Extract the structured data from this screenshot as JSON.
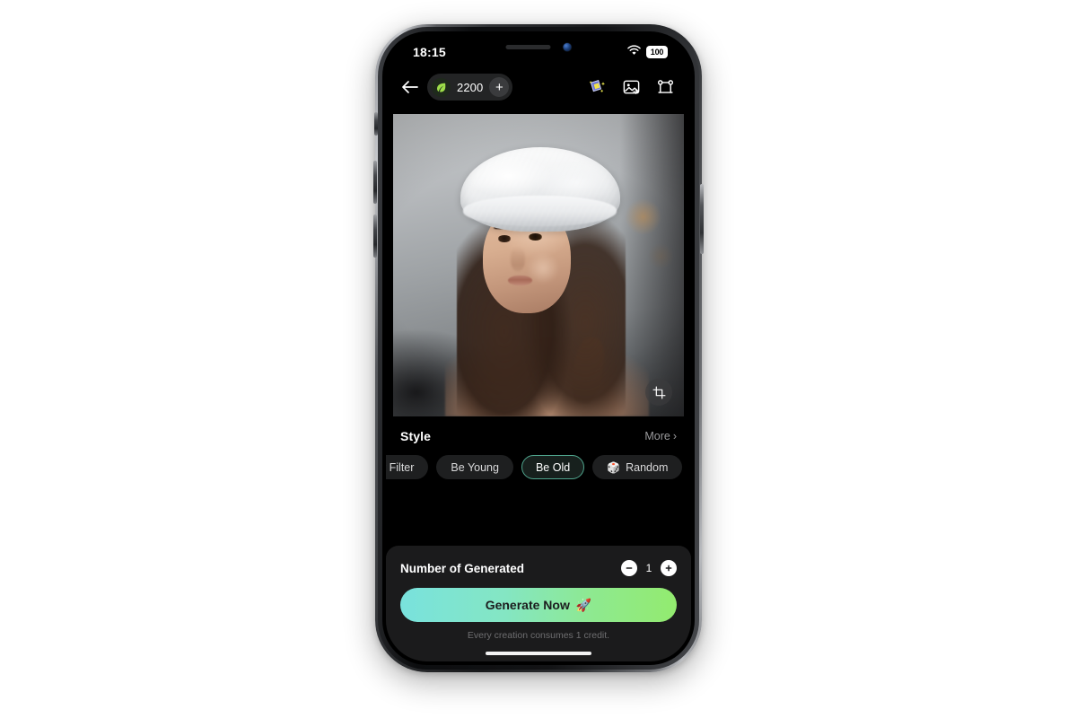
{
  "status_bar": {
    "time": "18:15",
    "wifi_icon": "wifi-icon",
    "battery_level": "100",
    "camera_icon": "front-camera-icon"
  },
  "top_bar": {
    "back_icon": "back-arrow-icon",
    "credit": {
      "leaf_icon": "leaf-icon",
      "value": "2200",
      "add_label": "+"
    },
    "actions": [
      {
        "name": "ai-magic-card-icon",
        "label": "AI Magic"
      },
      {
        "name": "image-swap-icon",
        "label": "Image"
      },
      {
        "name": "canvas-frame-icon",
        "label": "Canvas"
      }
    ]
  },
  "preview": {
    "alt": "Portrait of a woman wearing a white fur hat",
    "crop_icon": "crop-icon"
  },
  "style": {
    "title": "Style",
    "more_label": "More",
    "more_chevron": "›",
    "chips": [
      {
        "label": "aby Filter",
        "selected": false,
        "icon": ""
      },
      {
        "label": "Be Young",
        "selected": false,
        "icon": ""
      },
      {
        "label": "Be Old",
        "selected": true,
        "icon": ""
      },
      {
        "label": "Random",
        "selected": false,
        "icon": "🎲"
      }
    ],
    "selected_accent": "#4fa58d"
  },
  "generate": {
    "count_label": "Number of Generated",
    "count_value": "1",
    "minus_label": "−",
    "plus_label": "+",
    "button_label": "Generate Now",
    "button_emoji": "🚀",
    "note": "Every creation consumes 1 credit.",
    "gradient_start": "#79e2dd",
    "gradient_end": "#93eb6f"
  }
}
